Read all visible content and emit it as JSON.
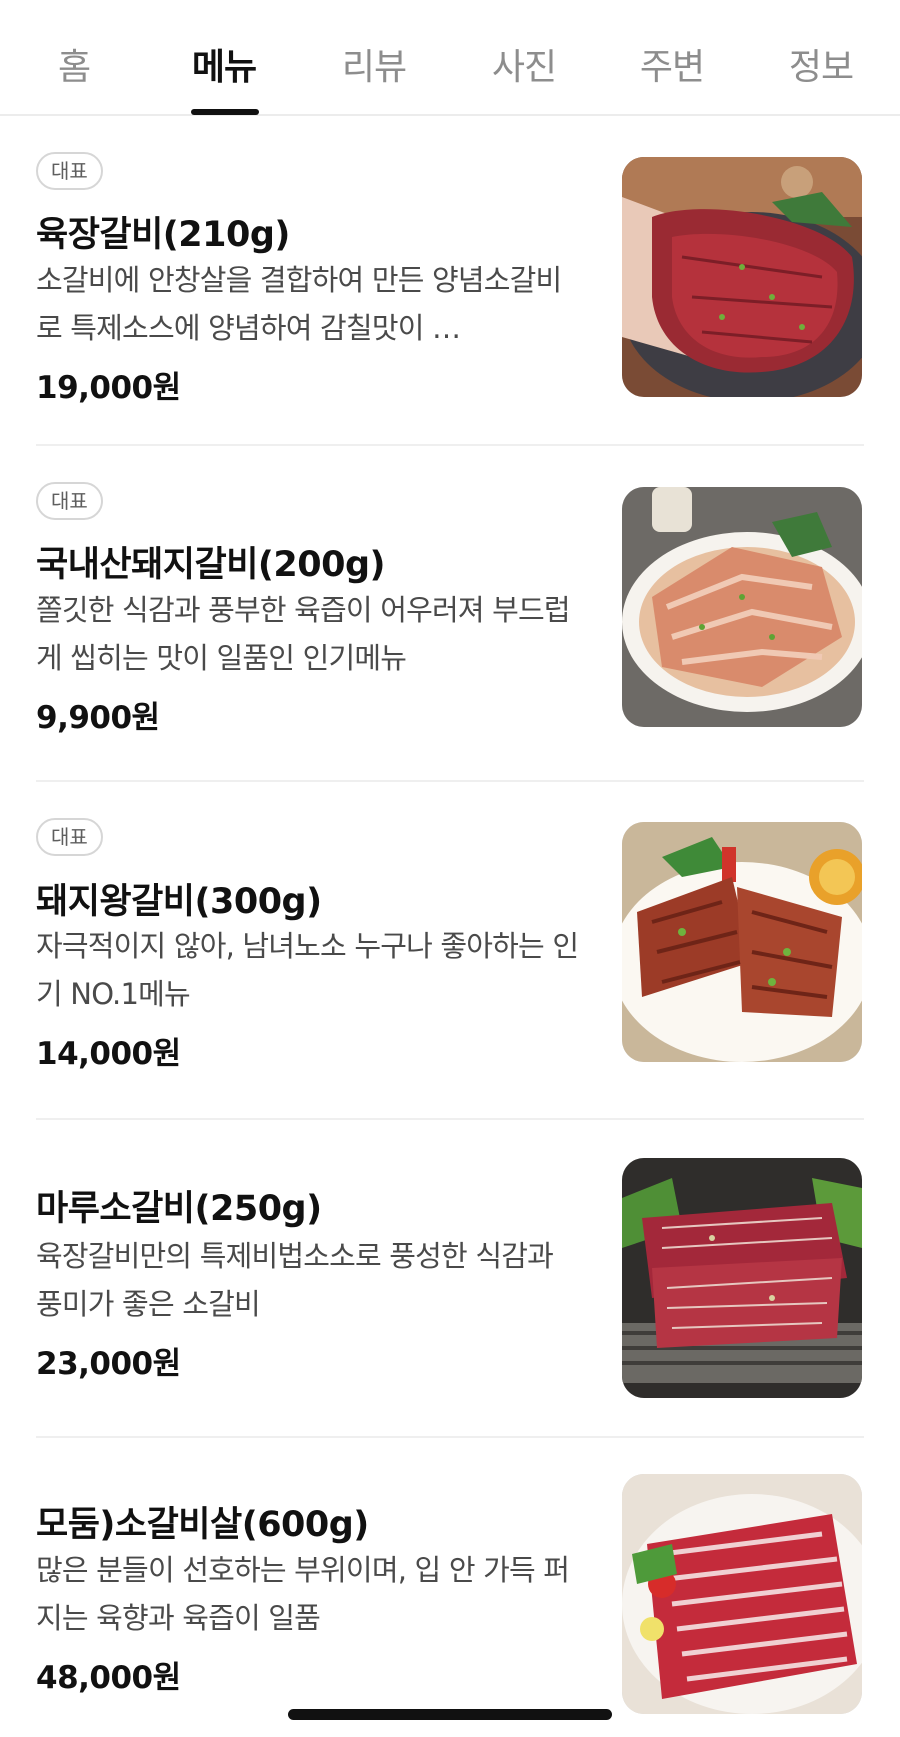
{
  "tabs": [
    {
      "label": "홈",
      "active": false
    },
    {
      "label": "메뉴",
      "active": true
    },
    {
      "label": "리뷰",
      "active": false
    },
    {
      "label": "사진",
      "active": false
    },
    {
      "label": "주변",
      "active": false
    },
    {
      "label": "정보",
      "active": false
    }
  ],
  "menu_items": [
    {
      "badge": "대표",
      "name": "육장갈비(210g)",
      "description": "소갈비에 안창살을 결합하여 만든 양념소갈비로 특제소스에 양념하여 감칠맛이 …",
      "price": "19,000원",
      "image": "marinated-beef-rib-platter"
    },
    {
      "badge": "대표",
      "name": "국내산돼지갈비(200g)",
      "description": "쫄깃한 식감과 풍부한 육즙이 어우러져 부드럽게 씹히는 맛이 일품인 인기메뉴",
      "price": "9,900원",
      "image": "marinated-pork-rib-plate"
    },
    {
      "badge": "대표",
      "name": "돼지왕갈비(300g)",
      "description": "자극적이지 않아, 남녀노소 누구나 좋아하는 인기 NO.1메뉴",
      "price": "14,000원",
      "image": "pork-king-rib-plate"
    },
    {
      "badge": "",
      "name": "마루소갈비(250g)",
      "description": "육장갈비만의 특제비법소소로 풍성한 식감과 풍미가 좋은 소갈비",
      "price": "23,000원",
      "image": "beef-rib-on-grill-tray"
    },
    {
      "badge": "",
      "name": "모둠)소갈비살(600g)",
      "description": "많은 분들이 선호하는 부위이며, 입 안 가득 퍼지는 육향과 육즙이 일품",
      "price": "48,000원",
      "image": "assorted-beef-rib-meat-platter"
    }
  ]
}
